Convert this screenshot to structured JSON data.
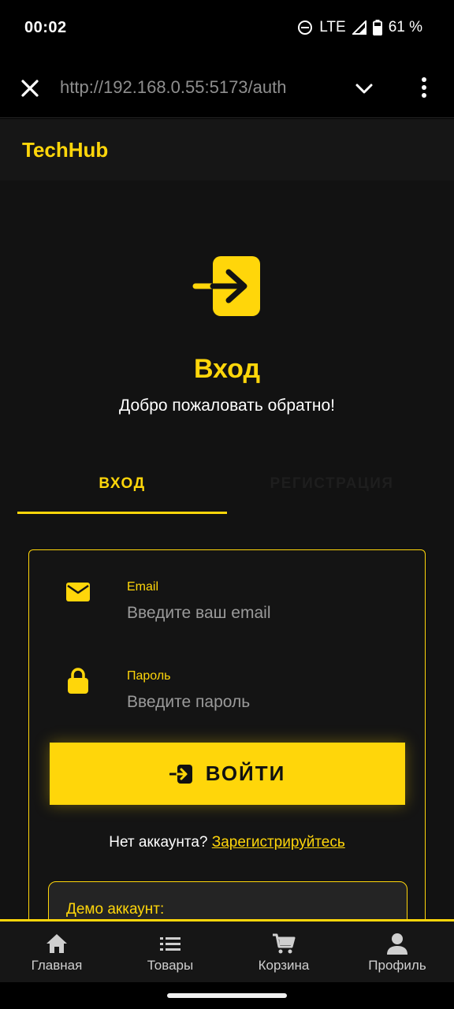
{
  "status_bar": {
    "time": "00:02",
    "network": "LTE",
    "battery": "61 %"
  },
  "browser": {
    "url": "http://192.168.0.55:5173/auth"
  },
  "app": {
    "brand": "TechHub"
  },
  "auth": {
    "title": "Вход",
    "subtitle": "Добро пожаловать обратно!",
    "tabs": [
      {
        "label": "ВХОД",
        "active": true
      },
      {
        "label": "РЕГИСТРАЦИЯ",
        "active": false
      }
    ],
    "email": {
      "label": "Email",
      "placeholder": "Введите ваш email",
      "value": ""
    },
    "password": {
      "label": "Пароль",
      "placeholder": "Введите пароль",
      "value": ""
    },
    "submit_label": "ВОЙТИ",
    "signup_prompt": "Нет аккаунта?",
    "signup_link": "Зарегистрируйтесь",
    "demo_title": "Демо аккаунт:"
  },
  "bottom_nav": [
    {
      "label": "Главная",
      "icon": "home-icon"
    },
    {
      "label": "Товары",
      "icon": "list-icon"
    },
    {
      "label": "Корзина",
      "icon": "cart-icon"
    },
    {
      "label": "Профиль",
      "icon": "user-icon"
    }
  ],
  "colors": {
    "accent": "#ffd60a",
    "background": "#121212",
    "header": "#161616"
  }
}
